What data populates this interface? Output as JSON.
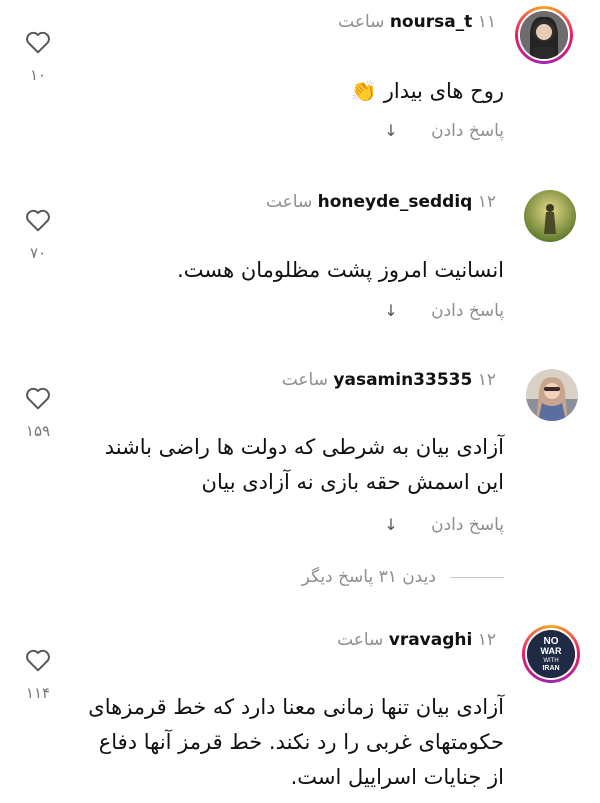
{
  "comments": [
    {
      "username": "noursa_t",
      "time": "۱۱ ساعت",
      "text": "روح های بیدار 👏",
      "reply_label": "پاسخ دادن",
      "like_count": "۱۰"
    },
    {
      "username": "honeyde_seddiq",
      "time": "۱۲ ساعت",
      "text": "انسانیت امروز پشت مظلومان هست.",
      "reply_label": "پاسخ دادن",
      "like_count": "۷۰"
    },
    {
      "username": "yasamin33535",
      "time": "۱۲ ساعت",
      "text": "آزادی بیان به شرطی که دولت ها راضی باشند این اسمش حقه بازی نه آزادی بیان",
      "reply_label": "پاسخ دادن",
      "like_count": "۱۵۹",
      "view_replies": "دیدن ۳۱ پاسخ دیگر"
    },
    {
      "username": "vravaghi",
      "time": "۱۲ ساعت",
      "text": "آزادی بیان تنها زمانی معنا دارد که خط قرمزهای حکومتهای غربی را رد نکند. خط قرمز آنها دفاع از جنایات اسراییل است.",
      "like_count": "۱۱۴"
    }
  ],
  "avatar4_text": [
    "NO",
    "WAR",
    "WITH",
    "IRAN"
  ],
  "icons": {
    "like": "heart-outline-icon",
    "reply_arrow": "arrow-down-icon"
  },
  "colors": {
    "story_ring": [
      "#f9a825",
      "#e91e63",
      "#9c27b0"
    ],
    "muted_text": "#8e8e8e"
  }
}
